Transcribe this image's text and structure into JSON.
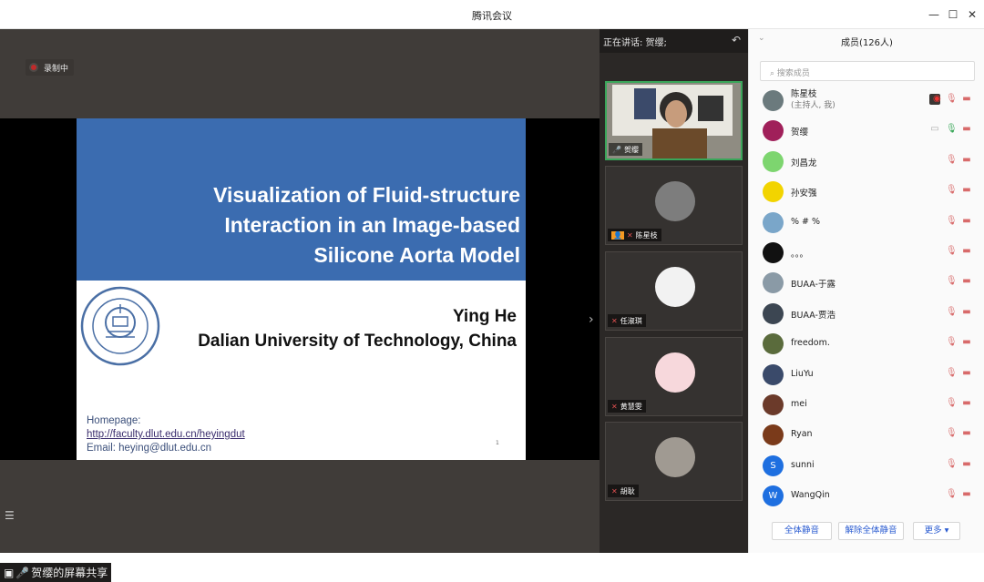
{
  "window": {
    "title": "腾讯会议"
  },
  "stage": {
    "recording_label": "录制中",
    "screen_share_label": "贺缨的屏幕共享"
  },
  "slide": {
    "title_lines": [
      "Visualization of Fluid-structure",
      "Interaction in an Image-based",
      "Silicone Aorta Model"
    ],
    "author": "Ying He",
    "affiliation": "Dalian University of Technology, China",
    "homepage_label": "Homepage:",
    "homepage_url": "http://faculty.dlut.edu.cn/heyingdut",
    "email": "Email: heying@dlut.edu.cn",
    "page_number": "1"
  },
  "videos": {
    "speaking": "正在讲话: 贺缨;",
    "tiles": [
      {
        "name": "贺缨",
        "color": "#c9b08a"
      },
      {
        "name": "陈星枝",
        "color": "#777"
      },
      {
        "name": "任淑琪",
        "color": "#f2f2f2"
      },
      {
        "name": "黄慧雯",
        "color": "#f7d8dc"
      },
      {
        "name": "胡耿",
        "color": "#a09a92"
      }
    ]
  },
  "members": {
    "header": "成员(126人)",
    "search_placeholder": "搜索成员",
    "list": [
      {
        "name": "陈星枝",
        "sub": "(主持人, 我)",
        "color": "#6b7a7d"
      },
      {
        "name": "贺缨",
        "color": "#a0205a"
      },
      {
        "name": "刘昌龙",
        "color": "#7dd56f"
      },
      {
        "name": "孙安强",
        "color": "#f2d400"
      },
      {
        "name": "% # %",
        "color": "#7aa6c9"
      },
      {
        "name": "。。。",
        "color": "#111111"
      },
      {
        "name": "BUAA-于露",
        "color": "#8a9aa6"
      },
      {
        "name": "BUAA-贾浩",
        "color": "#3c4652"
      },
      {
        "name": "freedom.",
        "color": "#5a6b3c"
      },
      {
        "name": "LiuYu",
        "color": "#3a4a6a"
      },
      {
        "name": "mei",
        "color": "#6b3a2a"
      },
      {
        "name": "Ryan",
        "color": "#7a3a1a"
      },
      {
        "name": "sunni",
        "color": "#1e6fe0",
        "initial": "S"
      },
      {
        "name": "WangQin",
        "color": "#1e6fe0",
        "initial": "W"
      }
    ],
    "buttons": {
      "mute_all": "全体静音",
      "unmute_all": "解除全体静音",
      "more": "更多 ▾"
    }
  }
}
